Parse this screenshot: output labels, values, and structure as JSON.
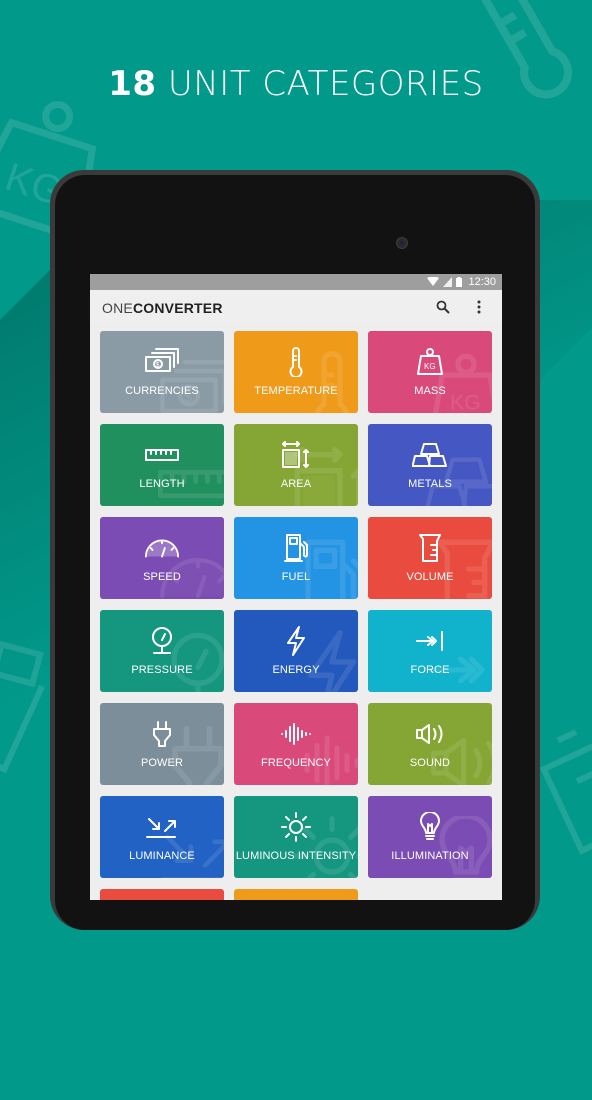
{
  "headline": {
    "count": "18",
    "text": "UNIT CATEGORIES"
  },
  "status_bar": {
    "time": "12:30"
  },
  "app": {
    "title_light": "ONE",
    "title_bold": "CONVERTER",
    "search_icon": "search-icon",
    "menu_icon": "more-vert-icon"
  },
  "colors": {
    "background": "#01998a",
    "currencies": "#8a9ba6",
    "temperature": "#f09a19",
    "mass": "#d94a7a",
    "length": "#21905f",
    "area": "#85a634",
    "metals": "#4457c2",
    "speed": "#7b4cb3",
    "fuel": "#2394e3",
    "volume": "#e94c3f",
    "pressure": "#14967f",
    "energy": "#2359bd",
    "force": "#11b2cc",
    "power": "#7c8e99",
    "frequency": "#d94a7a",
    "sound": "#85a634",
    "luminance": "#2262c4",
    "luminous_intensity": "#14967f",
    "illumination": "#7b4cb3",
    "tile_19": "#e94c3f",
    "tile_20": "#f09a19"
  },
  "categories": [
    {
      "label": "CURRENCIES",
      "icon": "currency-icon",
      "color": "#8a9ba6"
    },
    {
      "label": "TEMPERATURE",
      "icon": "thermometer-icon",
      "color": "#f09a19"
    },
    {
      "label": "MASS",
      "icon": "weight-kg-icon",
      "color": "#d94a7a"
    },
    {
      "label": "LENGTH",
      "icon": "ruler-icon",
      "color": "#21905f"
    },
    {
      "label": "AREA",
      "icon": "area-icon",
      "color": "#85a634"
    },
    {
      "label": "METALS",
      "icon": "gold-bars-icon",
      "color": "#4457c2"
    },
    {
      "label": "SPEED",
      "icon": "speedometer-icon",
      "color": "#7b4cb3"
    },
    {
      "label": "FUEL",
      "icon": "fuel-pump-icon",
      "color": "#2394e3"
    },
    {
      "label": "VOLUME",
      "icon": "measuring-cup-icon",
      "color": "#e94c3f"
    },
    {
      "label": "PRESSURE",
      "icon": "pressure-gauge-icon",
      "color": "#14967f"
    },
    {
      "label": "ENERGY",
      "icon": "lightning-icon",
      "color": "#2359bd"
    },
    {
      "label": "FORCE",
      "icon": "force-arrow-icon",
      "color": "#11b2cc"
    },
    {
      "label": "POWER",
      "icon": "plug-icon",
      "color": "#7c8e99"
    },
    {
      "label": "FREQUENCY",
      "icon": "waveform-icon",
      "color": "#d94a7a"
    },
    {
      "label": "SOUND",
      "icon": "speaker-icon",
      "color": "#85a634"
    },
    {
      "label": "LUMINANCE",
      "icon": "luminance-icon",
      "color": "#2262c4"
    },
    {
      "label": "LUMINOUS INTENSITY",
      "icon": "sun-icon",
      "color": "#14967f"
    },
    {
      "label": "ILLUMINATION",
      "icon": "light-bulb-icon",
      "color": "#7b4cb3"
    },
    {
      "label": "",
      "icon": "",
      "color": "#e94c3f"
    },
    {
      "label": "",
      "icon": "",
      "color": "#f09a19"
    }
  ]
}
